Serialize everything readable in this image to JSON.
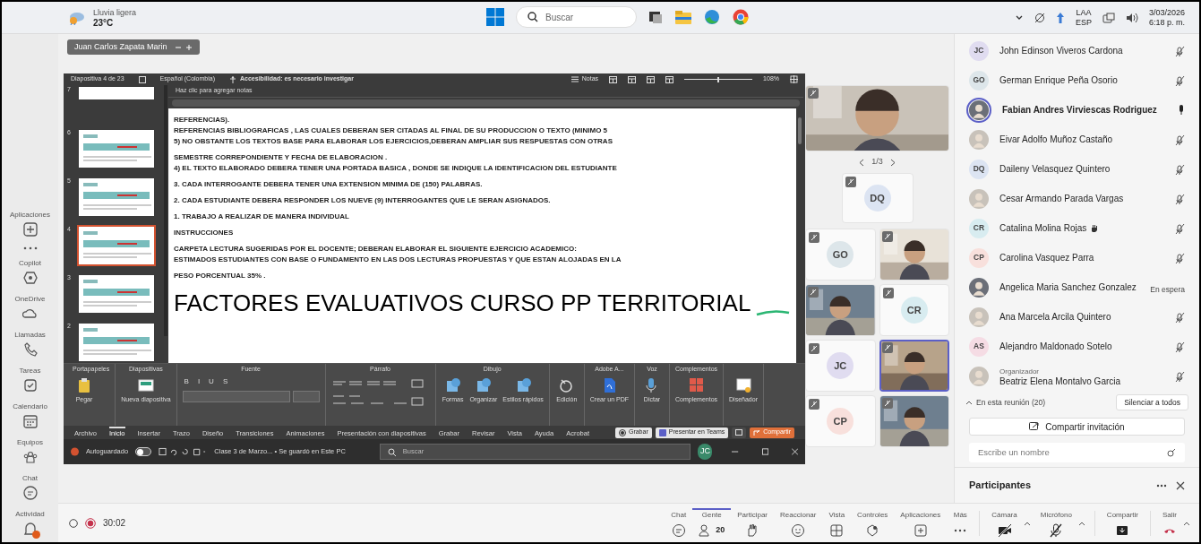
{
  "taskbar": {
    "weather_condition": "Lluvia ligera",
    "temperature": "23°C",
    "search_placeholder": "Buscar",
    "language": "ESP",
    "keyboard": "LAA",
    "time": "6:18 p. m.",
    "date": "3/03/2026"
  },
  "rail": [
    {
      "kind": "apps",
      "label": "Aplicaciones"
    },
    {
      "kind": "more"
    },
    {
      "kind": "copilot",
      "label": "Copilot"
    },
    {
      "kind": "onedrive",
      "label": "OneDrive"
    },
    {
      "kind": "calls",
      "label": "Llamadas"
    },
    {
      "kind": "tasks",
      "label": "Tareas"
    },
    {
      "kind": "calendar",
      "label": "Calendario"
    },
    {
      "kind": "teams",
      "label": "Equipos"
    },
    {
      "kind": "chat",
      "label": "Chat"
    },
    {
      "kind": "activity",
      "label": "Actividad",
      "badge": true
    }
  ],
  "presenter_tag": "Juan Carlos Zapata Marin",
  "powerpoint": {
    "status": {
      "slide": "Diapositiva 4 de 23",
      "language": "Español (Colombia)",
      "accessibility": "Accesibilidad: es necesario investigar",
      "notes": "Notas",
      "zoom": "108%",
      "zoom_slider": {
        "level": 0.5
      }
    },
    "notes_placeholder": "Haz clic para agregar notas",
    "thumbnails": [
      {
        "number": "7",
        "selected": false
      },
      {
        "number": "6",
        "selected": false
      },
      {
        "number": "5",
        "selected": false
      },
      {
        "number": "4",
        "selected": true
      },
      {
        "number": "3",
        "selected": false
      },
      {
        "number": "2",
        "selected": false
      }
    ],
    "slide": {
      "paragraphs": [
        [
          "REFERENCIAS).",
          "REFERENCIAS BIBLIOGRAFICAS , LAS CUALES DEBERAN SER CITADAS AL FINAL DE SU PRODUCCION O TEXTO (MINIMO 5",
          "5) NO OBSTANTE LOS  TEXTOS BASE PARA ELABORAR LOS EJERCICIOS,DEBERAN AMPLIAR SUS RESPUESTAS CON OTRAS"
        ],
        [
          "SEMESTRE CORREPONDIENTE Y FECHA DE ELABORACION .",
          "4) EL TEXTO ELABORADO DEBERA TENER UNA PORTADA BASICA , DONDE SE INDIQUE LA IDENTIFICACION DEL ESTUDIANTE"
        ],
        [
          "3. CADA INTERROGANTE DEBERA TENER UNA EXTENSION MINIMA DE (150) PALABRAS."
        ],
        [
          "2. CADA ESTUDIANTE DEBERA RESPONDER LOS NUEVE (9) INTERROGANTES QUE LE SERAN ASIGNADOS."
        ],
        [
          "1. TRABAJO A REALIZAR DE MANERA INDIVIDUAL"
        ],
        [
          "INSTRUCCIONES"
        ],
        [
          "CARPETA LECTURA SUGERIDAS POR EL DOCENTE; DEBERAN ELABORAR EL SIGUIENTE EJERCICIO ACADEMICO:",
          "ESTIMADOS ESTUDIANTES CON BASE O FUNDAMENTO EN LAS DOS LECTURAS PROPUESTAS Y QUE ESTAN ALOJADAS EN LA"
        ],
        [
          "PESO PORCENTUAL 35% ."
        ]
      ],
      "title": "FACTORES EVALUATIVOS CURSO PP TERRITORIAL"
    },
    "ribbon": [
      {
        "label": "Portapapeles",
        "kind": "clipboard",
        "buttons": [
          "Pegar"
        ]
      },
      {
        "label": "Diapositivas",
        "kind": "slides",
        "buttons": [
          "Nueva diapositiva"
        ]
      },
      {
        "label": "Fuente",
        "kind": "font",
        "buttons": [
          "B",
          "I",
          "U",
          "S"
        ]
      },
      {
        "label": "Párrafo",
        "kind": "paragraph"
      },
      {
        "label": "Dibujo",
        "kind": "drawing",
        "buttons": [
          "Formas",
          "Organizar",
          "Estilos rápidos"
        ]
      },
      {
        "kind": "editing",
        "buttons": [
          "Edición"
        ]
      },
      {
        "label": "Adobe A...",
        "kind": "pdf",
        "buttons": [
          "Crear un PDF"
        ]
      },
      {
        "label": "Voz",
        "kind": "voice",
        "buttons": [
          "Dictar"
        ]
      },
      {
        "label": "Complementos",
        "kind": "addins",
        "buttons": [
          "Complementos"
        ]
      },
      {
        "kind": "designer",
        "buttons": [
          "Diseñador"
        ]
      }
    ],
    "tabs": [
      {
        "label": "Archivo",
        "selected": false
      },
      {
        "label": "Inicio",
        "selected": true
      },
      {
        "label": "Insertar",
        "selected": false
      },
      {
        "label": "Trazo",
        "selected": false
      },
      {
        "label": "Diseño",
        "selected": false
      },
      {
        "label": "Transiciones",
        "selected": false
      },
      {
        "label": "Animaciones",
        "selected": false
      },
      {
        "label": "Presentación con diapositivas",
        "selected": false
      },
      {
        "label": "Grabar",
        "selected": false
      },
      {
        "label": "Revisar",
        "selected": false
      },
      {
        "label": "Vista",
        "selected": false
      },
      {
        "label": "Ayuda",
        "selected": false
      },
      {
        "label": "Acrobat",
        "selected": false
      }
    ],
    "actions": [
      {
        "label": "Grabar",
        "kind": "record"
      },
      {
        "label": "Presentar en Teams",
        "kind": "present"
      },
      {
        "kind": "comment"
      },
      {
        "label": "Compartir",
        "kind": "share"
      }
    ],
    "titlebar": {
      "autosave": "Autoguardado",
      "autosave_on": false,
      "document": "Clase 3 de Marzo... • Se guardó en Este PC",
      "search_placeholder": "Buscar",
      "user_initials": "JC"
    }
  },
  "video": {
    "pager": "1/3",
    "tiles": [
      {
        "kind": "picture",
        "active": false
      },
      {
        "kind": "initials",
        "initials": "DQ",
        "color": "#dce4f2",
        "active": false
      },
      {
        "kind": "initials",
        "initials": "GO",
        "color": "#dde6ea",
        "active": false
      },
      {
        "kind": "picture",
        "active": false
      },
      {
        "kind": "picture",
        "active": false
      },
      {
        "kind": "initials",
        "initials": "CR",
        "color": "#d8ecf0",
        "active": false
      },
      {
        "kind": "initials",
        "initials": "JC",
        "color": "#e0dcf0",
        "active": false
      },
      {
        "kind": "picture",
        "active": true
      },
      {
        "kind": "initials",
        "initials": "CP",
        "color": "#f8e0dc",
        "active": false
      },
      {
        "kind": "picture",
        "active": false
      }
    ]
  },
  "participants": {
    "people": [
      {
        "kind": "initials",
        "initials": "JC",
        "color": "#e0dcf0",
        "name": "John Edinson Viveros Cardona",
        "muted": true
      },
      {
        "kind": "initials",
        "initials": "GO",
        "color": "#dde6ea",
        "name": "German Enrique Peña Osorio",
        "muted": true
      },
      {
        "name": "Fabian Andres Virviescas Rodriguez",
        "muted": false,
        "speaking": true
      },
      {
        "name": "Eivar Adolfo Muñoz Castaño",
        "muted": true
      },
      {
        "kind": "initials",
        "initials": "DQ",
        "color": "#dce4f2",
        "name": "Daileny Velasquez Quintero",
        "muted": true
      },
      {
        "name": "Cesar Armando Parada Vargas",
        "muted": true
      },
      {
        "kind": "initials",
        "initials": "CR",
        "color": "#d8ecf0",
        "name": "Catalina Molina Rojas",
        "muted": true,
        "hand": true
      },
      {
        "kind": "initials",
        "initials": "CP",
        "color": "#f8e0dc",
        "name": "Carolina Vasquez Parra",
        "muted": true
      },
      {
        "name": "Angelica Maria Sanchez Gonzalez",
        "status": "En espera"
      },
      {
        "name": "Ana Marcela Arcila Quintero",
        "muted": true
      },
      {
        "kind": "initials",
        "initials": "AS",
        "color": "#f5dce4",
        "name": "Alejandro Maldonado Sotelo",
        "muted": true
      },
      {
        "name": "Beatriz Elena Montalvo Garcia",
        "role": "Organizador",
        "muted": true
      }
    ],
    "section": "En esta reunión (20)",
    "mute_all": "Silenciar a todos",
    "invite": "Compartir invitación",
    "search_placeholder": "Escribe un nombre",
    "title": "Participantes"
  },
  "meeting_bar": {
    "timer": "30:02",
    "recording": true,
    "controls": [
      {
        "kind": "chat",
        "label": "Chat",
        "selected": false
      },
      {
        "kind": "people",
        "label": "Gente",
        "count": "20",
        "selected": true
      },
      {
        "kind": "raise",
        "label": "Participar",
        "selected": false
      },
      {
        "kind": "react",
        "label": "Reaccionar",
        "selected": false
      },
      {
        "kind": "view",
        "label": "Vista",
        "selected": false
      },
      {
        "kind": "controls",
        "label": "Controles",
        "selected": false
      },
      {
        "kind": "apps",
        "label": "Aplicaciones",
        "selected": false
      },
      {
        "kind": "more",
        "label": "Más",
        "selected": false
      },
      {
        "kind": "camera",
        "label": "Cámara",
        "on": false
      },
      {
        "kind": "mic",
        "label": "Micrófono",
        "on": false
      },
      {
        "kind": "share",
        "label": "Compartir"
      },
      {
        "kind": "leave",
        "label": "Salir"
      }
    ]
  }
}
